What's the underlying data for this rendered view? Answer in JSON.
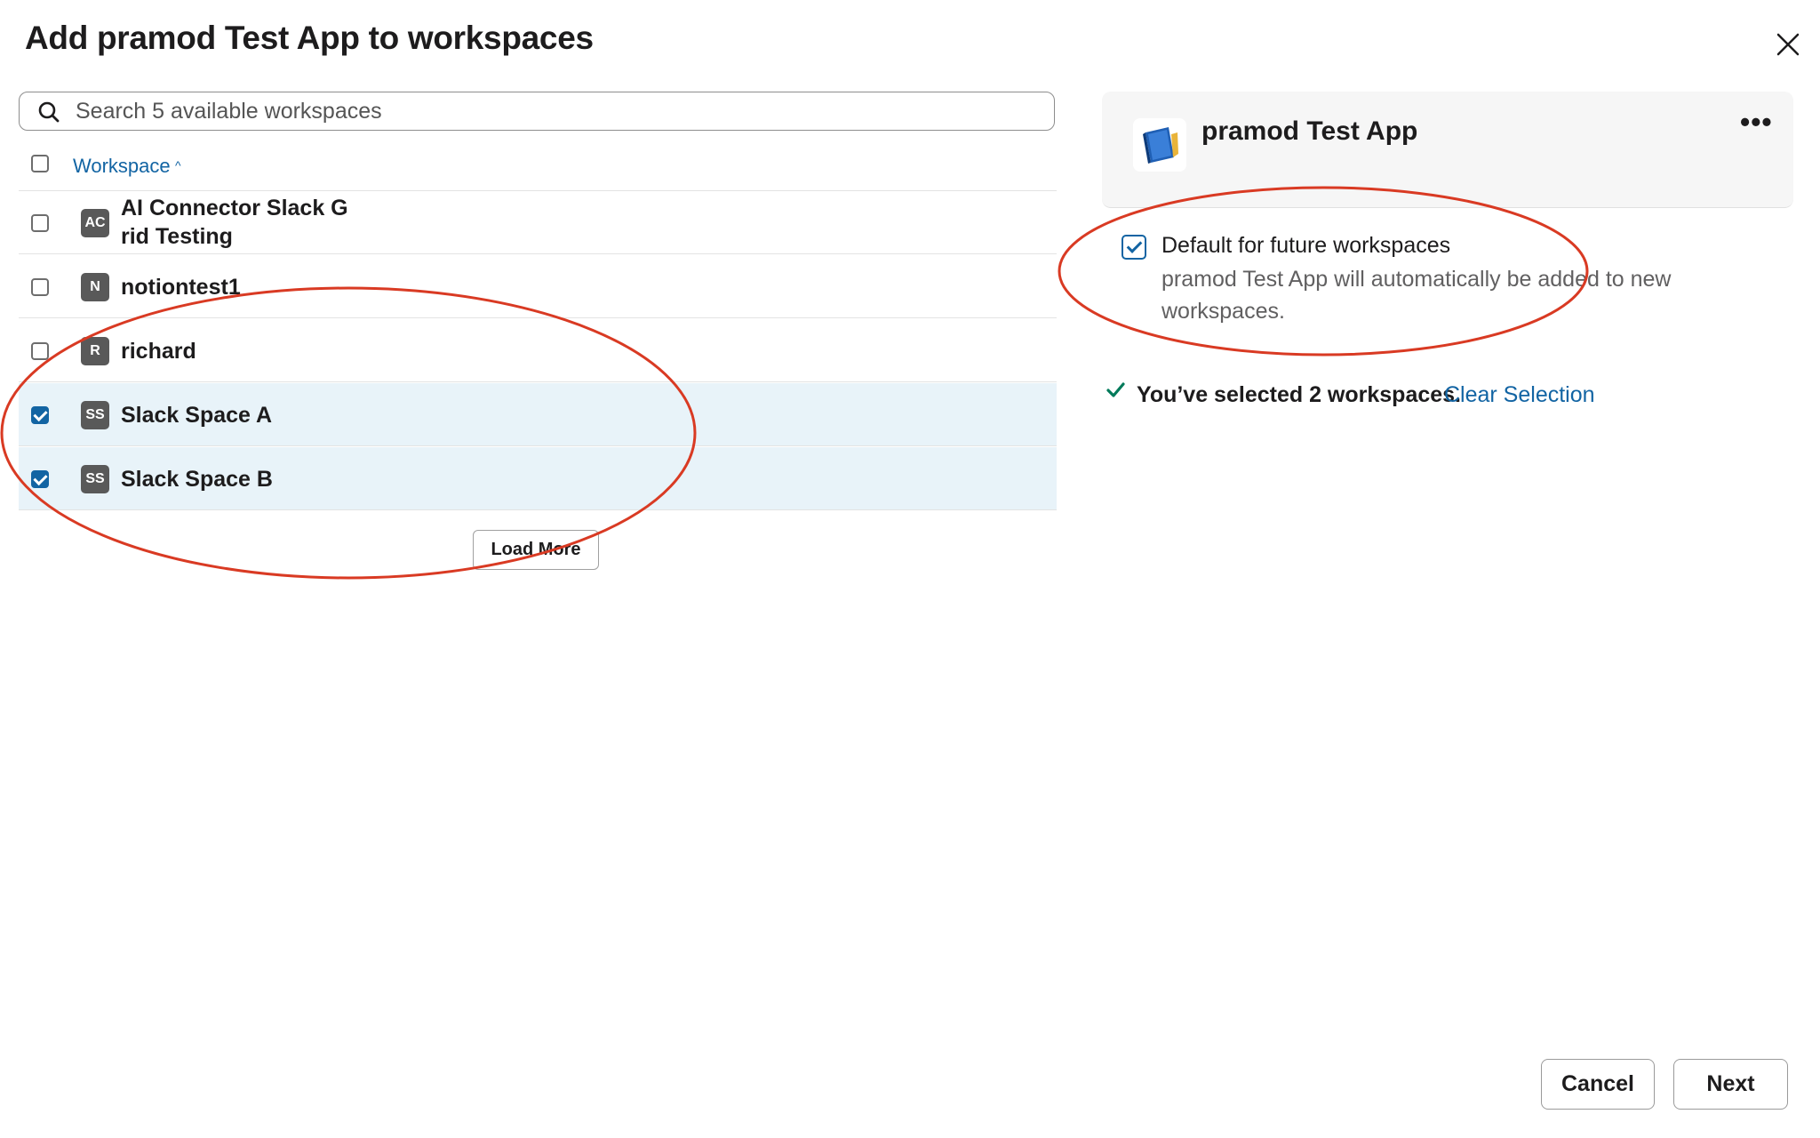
{
  "dialog": {
    "title": "Add pramod Test App to workspaces",
    "close_icon": "close-icon"
  },
  "search": {
    "placeholder": "Search 5 available workspaces",
    "value": "",
    "icon": "search-icon"
  },
  "table": {
    "header_label": "Workspace",
    "sort_icon": "chevron-up-icon",
    "rows": [
      {
        "avatar": "AC",
        "name": "AI Connector Slack G rid Testing",
        "checked": false
      },
      {
        "avatar": "N",
        "name": "notiontest1",
        "checked": false
      },
      {
        "avatar": "R",
        "name": "richard",
        "checked": false
      },
      {
        "avatar": "SS",
        "name": "Slack Space A",
        "checked": true
      },
      {
        "avatar": "SS",
        "name": "Slack Space B",
        "checked": true
      }
    ],
    "load_more_label": "Load More"
  },
  "app": {
    "name": "pramod Test App",
    "icon": "app-book-icon",
    "more_label": "•••"
  },
  "default_option": {
    "checked": true,
    "title": "Default for future workspaces",
    "description": "pramod Test App will automatically be added to new workspaces."
  },
  "selection": {
    "summary": "You’ve selected 2 workspaces.",
    "clear_label": "Clear Selection"
  },
  "footer": {
    "cancel_label": "Cancel",
    "next_label": "Next"
  },
  "colors": {
    "accent": "#1264a3",
    "selected_row": "#e8f3f9",
    "annotation": "#d93a23",
    "check_green": "#007a5a"
  }
}
